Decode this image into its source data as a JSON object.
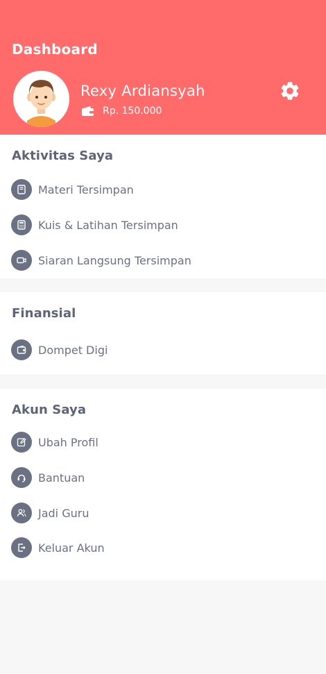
{
  "header": {
    "title": "Dashboard",
    "user_name": "Rexy Ardiansyah",
    "balance": "Rp. 150.000",
    "background_color": "#ff6b6b"
  },
  "sections": {
    "aktivitas": {
      "title": "Aktivitas Saya",
      "items": [
        {
          "label": "Materi Tersimpan",
          "icon": "book-icon"
        },
        {
          "label": "Kuis & Latihan Tersimpan",
          "icon": "calculator-icon"
        },
        {
          "label": "Siaran Langsung Tersimpan",
          "icon": "video-icon"
        }
      ]
    },
    "finansial": {
      "title": "Finansial",
      "items": [
        {
          "label": "Dompet Digi",
          "icon": "wallet-icon"
        }
      ]
    },
    "akun": {
      "title": "Akun Saya",
      "items": [
        {
          "label": "Ubah Profil",
          "icon": "edit-icon"
        },
        {
          "label": "Bantuan",
          "icon": "headset-icon"
        },
        {
          "label": "Jadi Guru",
          "icon": "users-icon"
        },
        {
          "label": "Keluar Akun",
          "icon": "logout-icon"
        }
      ]
    }
  },
  "colors": {
    "accent": "#ff6b6b",
    "icon_bg": "#6b7183",
    "text": "#6b7183"
  }
}
